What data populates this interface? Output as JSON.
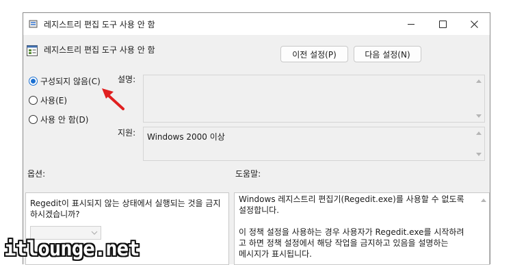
{
  "window": {
    "title": "레지스트리 편집 도구 사용 안 함",
    "policy_name": "레지스트리 편집 도구 사용 안 함",
    "minimize_label": "–",
    "maximize_label": "☐",
    "close_label": "✕"
  },
  "buttons": {
    "prev": "이전 설정(P)",
    "next": "다음 설정(N)"
  },
  "radios": [
    {
      "label": "구성되지 않음(C)",
      "selected": true
    },
    {
      "label": "사용(E)",
      "selected": false
    },
    {
      "label": "사용 안 함(D)",
      "selected": false
    }
  ],
  "labels": {
    "description": "설명:",
    "supported": "지원:",
    "options": "옵션:",
    "help": "도움말:"
  },
  "supported_value": "Windows 2000 이상",
  "options_text": "Regedit이 표시되지 않는 상태에서 실행되는 것을 금지하시겠습니까?",
  "help_lines": [
    "Windows 레지스트리 편집기(Regedit.exe)를 사용할 수 없도록",
    "설정합니다.",
    "",
    "이 정책 설정을 사용하는 경우 사용자가 Regedit.exe를 시작하려",
    "고 하면 정책 설정에서 해당 작업을 금지하고 있음을 설명하는",
    "메시지가 표시됩니다."
  ],
  "watermark": "itlounge.net",
  "colors": {
    "accent": "#1a6fd1",
    "annotation_arrow": "#e02020",
    "window_bg": "#f0f0f0"
  }
}
